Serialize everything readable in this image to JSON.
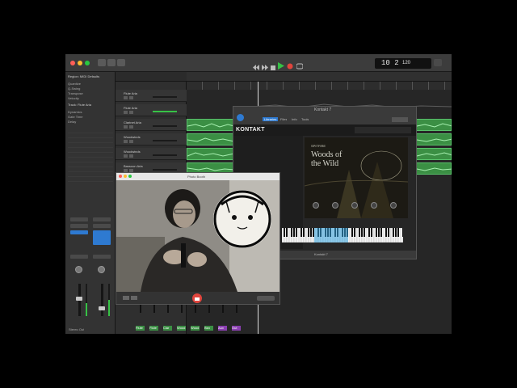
{
  "logic": {
    "lcd_position": "10 2",
    "lcd_tempo": "120",
    "colors": {
      "region": "#3b8f44",
      "region_border": "#58c06a",
      "accent_blue": "#2e7ad1",
      "record": "#e0453d"
    }
  },
  "inspector": {
    "region_header": "Region: MIDI Defaults",
    "track_header": "Track: Flute Aria",
    "output": "Stereo Out",
    "rows": [
      "Quantize",
      "Q-Swing",
      "Transpose",
      "Velocity",
      "Dynamics",
      "Gate Time",
      "Delay"
    ]
  },
  "tracks": [
    {
      "name": "Flute Aria"
    },
    {
      "name": "Flute Aria"
    },
    {
      "name": "Clarinet Aria"
    },
    {
      "name": "Woodwinds"
    },
    {
      "name": "Woodwinds"
    },
    {
      "name": "Bassoon Aria"
    }
  ],
  "kontakt": {
    "window_title": "Kontakt 7",
    "logo": "KONTAKT",
    "instrument_brand": "SPITFIRE",
    "instrument_title": "Woods of the Wild",
    "footer": "Kontakt 7",
    "tabs": [
      "Libraries",
      "Files",
      "Info",
      "Tools"
    ]
  },
  "video": {
    "window_title": "Photo Booth"
  },
  "mixer_labels": [
    "Flute",
    "Flute",
    "Clar",
    "Wood",
    "Wood",
    "Bsn",
    "Aux",
    "Out"
  ]
}
